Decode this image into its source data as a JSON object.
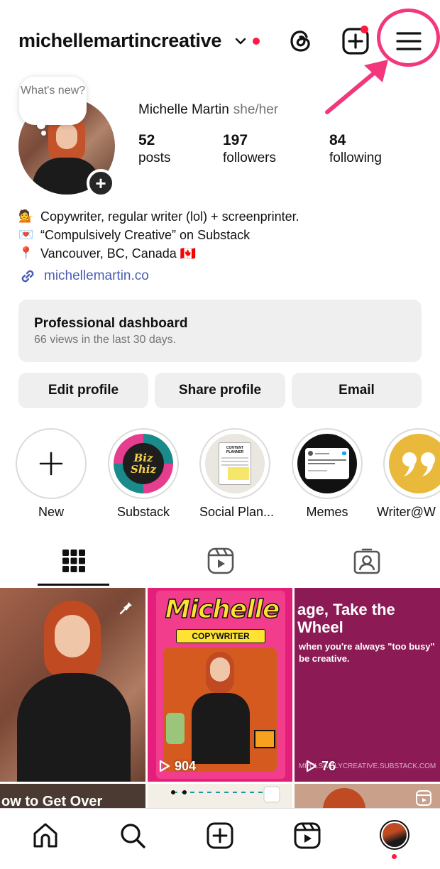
{
  "header": {
    "username": "michellemartincreative"
  },
  "profile": {
    "note_text": "What's new?",
    "full_name": "Michelle Martin",
    "pronouns": "she/her",
    "stats": [
      {
        "number": "52",
        "label": "posts"
      },
      {
        "number": "197",
        "label": "followers"
      },
      {
        "number": "84",
        "label": "following"
      }
    ],
    "bio": [
      {
        "emoji": "💁",
        "text": "Copywriter, regular writer (lol) + screenprinter."
      },
      {
        "emoji": "💌",
        "text": "“Compulsively Creative” on Substack"
      },
      {
        "emoji": "📍",
        "text": "Vancouver, BC, Canada 🇨🇦"
      }
    ],
    "link": "michellemartin.co"
  },
  "dashboard": {
    "title": "Professional dashboard",
    "subtitle": "66 views in the last 30 days."
  },
  "buttons": {
    "edit": "Edit profile",
    "share": "Share profile",
    "email": "Email"
  },
  "highlights": [
    {
      "label": "New"
    },
    {
      "label": "Substack",
      "art_text": "Biz Shiz"
    },
    {
      "label": "Social Plan...",
      "art_text": "CONTENT PLANNER"
    },
    {
      "label": "Memes"
    },
    {
      "label": "Writer@W"
    }
  ],
  "posts": [
    {
      "views": ""
    },
    {
      "views": "904",
      "title": "Michelle",
      "subtitle": "COPYWRITER"
    },
    {
      "views": "76",
      "headline": "age, Take the Wheel",
      "subhead": "when you're always \"too busy\" be creative.",
      "footer": "MPULSIVELYCREATIVE.SUBSTACK.COM"
    }
  ],
  "second_row": {
    "left_caption": "ow to Get Over"
  },
  "colors": {
    "accent_pink": "#f2377d",
    "notification_red": "#ff1940",
    "link_blue": "#4a5cb3",
    "post_magenta": "#e41f7b",
    "post_purple": "#8b1a55"
  }
}
